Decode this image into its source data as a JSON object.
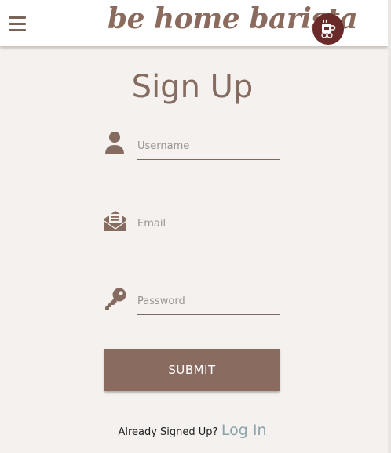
{
  "navbar": {
    "menu_icon": "hamburger-menu-icon",
    "brand": "be home barista",
    "logo_icon": "coffee-logo-icon"
  },
  "form": {
    "title": "Sign Up",
    "username": {
      "icon": "user-icon",
      "placeholder": "Username"
    },
    "email": {
      "icon": "envelope-open-icon",
      "placeholder": "Email"
    },
    "password": {
      "icon": "key-icon",
      "placeholder": "Password"
    },
    "submit_label": "SUBMIT"
  },
  "footer": {
    "prompt": "Already Signed Up?",
    "login_link": "Log In"
  },
  "colors": {
    "brand": "#8a6b5e",
    "button": "#8a6b60",
    "link": "#8aa3ab",
    "background": "#f4f1ee",
    "logo_bg": "#6b2a2a"
  }
}
